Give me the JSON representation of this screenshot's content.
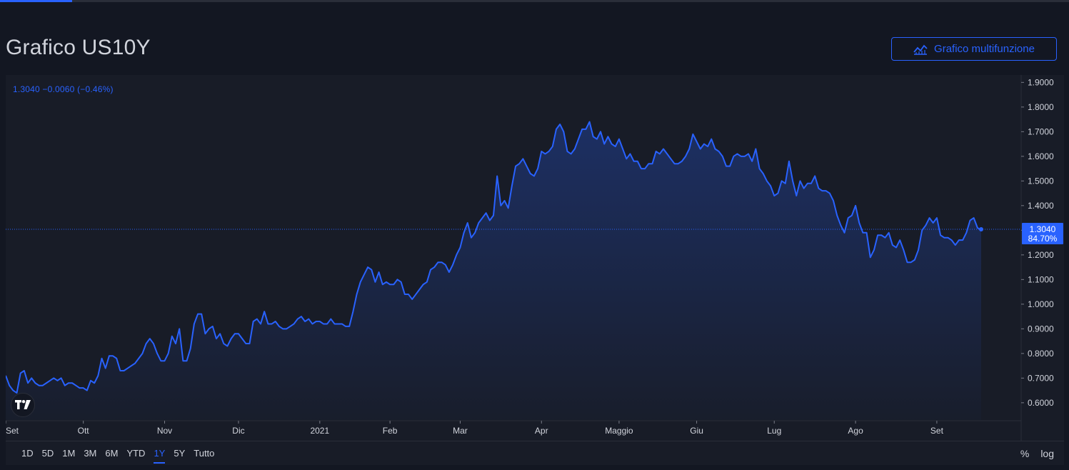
{
  "page": {
    "title": "Grafico US10Y"
  },
  "toolbar": {
    "multi_chart_label": "Grafico multifunzione",
    "multi_chart_icon": "chart-line-icon"
  },
  "legend": {
    "readout": "1.3040 −0.0060 (−0.46%)"
  },
  "price_tag": {
    "value": "1.3040",
    "percent": "84.70%"
  },
  "range_buttons": [
    {
      "label": "1D",
      "active": false
    },
    {
      "label": "5D",
      "active": false
    },
    {
      "label": "1M",
      "active": false
    },
    {
      "label": "3M",
      "active": false
    },
    {
      "label": "6M",
      "active": false
    },
    {
      "label": "YTD",
      "active": false
    },
    {
      "label": "1Y",
      "active": true
    },
    {
      "label": "5Y",
      "active": false
    },
    {
      "label": "Tutto",
      "active": false
    }
  ],
  "scale_toggles": [
    "%",
    "log"
  ],
  "colors": {
    "background": "#131722",
    "panel": "#181c27",
    "line": "#2962ff",
    "grid": "#2a2e39",
    "text": "#d1d4dc"
  },
  "chart_data": {
    "type": "area",
    "title": "Grafico US10Y",
    "xlabel": "",
    "ylabel": "",
    "ylim": [
      0.53,
      1.93
    ],
    "y_ticks": [
      "1.9000",
      "1.8000",
      "1.7000",
      "1.6000",
      "1.5000",
      "1.4000",
      "1.3000",
      "1.2000",
      "1.1000",
      "1.0000",
      "0.9000",
      "0.8000",
      "0.7000",
      "0.6000"
    ],
    "x_ticks": [
      {
        "label": "Set",
        "index": 0
      },
      {
        "label": "Ott",
        "index": 21
      },
      {
        "label": "Nov",
        "index": 43
      },
      {
        "label": "Dic",
        "index": 63
      },
      {
        "label": "2021",
        "index": 85
      },
      {
        "label": "Feb",
        "index": 104
      },
      {
        "label": "Mar",
        "index": 123
      },
      {
        "label": "Apr",
        "index": 145
      },
      {
        "label": "Maggio",
        "index": 166
      },
      {
        "label": "Giu",
        "index": 187
      },
      {
        "label": "Lug",
        "index": 208
      },
      {
        "label": "Ago",
        "index": 230
      },
      {
        "label": "Set",
        "index": 252
      }
    ],
    "last_value": 1.304,
    "grid": false,
    "series": [
      {
        "values": [
          0.71,
          0.67,
          0.65,
          0.64,
          0.72,
          0.73,
          0.68,
          0.7,
          0.68,
          0.67,
          0.67,
          0.68,
          0.69,
          0.7,
          0.69,
          0.7,
          0.67,
          0.68,
          0.68,
          0.67,
          0.66,
          0.66,
          0.65,
          0.69,
          0.68,
          0.71,
          0.78,
          0.74,
          0.79,
          0.79,
          0.78,
          0.73,
          0.73,
          0.74,
          0.75,
          0.76,
          0.78,
          0.8,
          0.84,
          0.86,
          0.84,
          0.8,
          0.77,
          0.77,
          0.8,
          0.87,
          0.84,
          0.9,
          0.77,
          0.77,
          0.82,
          0.92,
          0.96,
          0.96,
          0.88,
          0.9,
          0.91,
          0.86,
          0.88,
          0.84,
          0.83,
          0.86,
          0.88,
          0.88,
          0.86,
          0.84,
          0.84,
          0.93,
          0.94,
          0.92,
          0.97,
          0.92,
          0.92,
          0.93,
          0.91,
          0.9,
          0.9,
          0.91,
          0.92,
          0.94,
          0.95,
          0.93,
          0.94,
          0.92,
          0.93,
          0.93,
          0.92,
          0.92,
          0.94,
          0.92,
          0.92,
          0.92,
          0.91,
          0.91,
          0.97,
          1.04,
          1.09,
          1.12,
          1.15,
          1.14,
          1.09,
          1.13,
          1.08,
          1.09,
          1.08,
          1.08,
          1.1,
          1.09,
          1.04,
          1.04,
          1.02,
          1.04,
          1.06,
          1.08,
          1.09,
          1.14,
          1.15,
          1.17,
          1.17,
          1.16,
          1.13,
          1.16,
          1.2,
          1.23,
          1.29,
          1.33,
          1.27,
          1.29,
          1.33,
          1.35,
          1.37,
          1.34,
          1.36,
          1.52,
          1.4,
          1.42,
          1.39,
          1.48,
          1.56,
          1.57,
          1.59,
          1.56,
          1.53,
          1.52,
          1.55,
          1.62,
          1.61,
          1.62,
          1.64,
          1.71,
          1.73,
          1.7,
          1.62,
          1.61,
          1.63,
          1.67,
          1.71,
          1.71,
          1.74,
          1.68,
          1.67,
          1.7,
          1.65,
          1.68,
          1.65,
          1.64,
          1.67,
          1.63,
          1.59,
          1.61,
          1.58,
          1.58,
          1.55,
          1.55,
          1.57,
          1.57,
          1.62,
          1.61,
          1.63,
          1.61,
          1.59,
          1.57,
          1.57,
          1.58,
          1.6,
          1.63,
          1.69,
          1.66,
          1.63,
          1.65,
          1.64,
          1.67,
          1.63,
          1.62,
          1.6,
          1.56,
          1.56,
          1.6,
          1.61,
          1.6,
          1.6,
          1.61,
          1.58,
          1.63,
          1.55,
          1.53,
          1.5,
          1.48,
          1.44,
          1.45,
          1.5,
          1.49,
          1.58,
          1.5,
          1.44,
          1.5,
          1.47,
          1.49,
          1.49,
          1.52,
          1.47,
          1.46,
          1.46,
          1.45,
          1.42,
          1.36,
          1.32,
          1.29,
          1.35,
          1.36,
          1.4,
          1.33,
          1.29,
          1.29,
          1.19,
          1.22,
          1.28,
          1.28,
          1.27,
          1.29,
          1.24,
          1.23,
          1.26,
          1.22,
          1.17,
          1.17,
          1.18,
          1.22,
          1.3,
          1.32,
          1.35,
          1.33,
          1.35,
          1.28,
          1.27,
          1.27,
          1.26,
          1.24,
          1.26,
          1.26,
          1.29,
          1.34,
          1.35,
          1.31,
          1.3
        ]
      }
    ]
  }
}
